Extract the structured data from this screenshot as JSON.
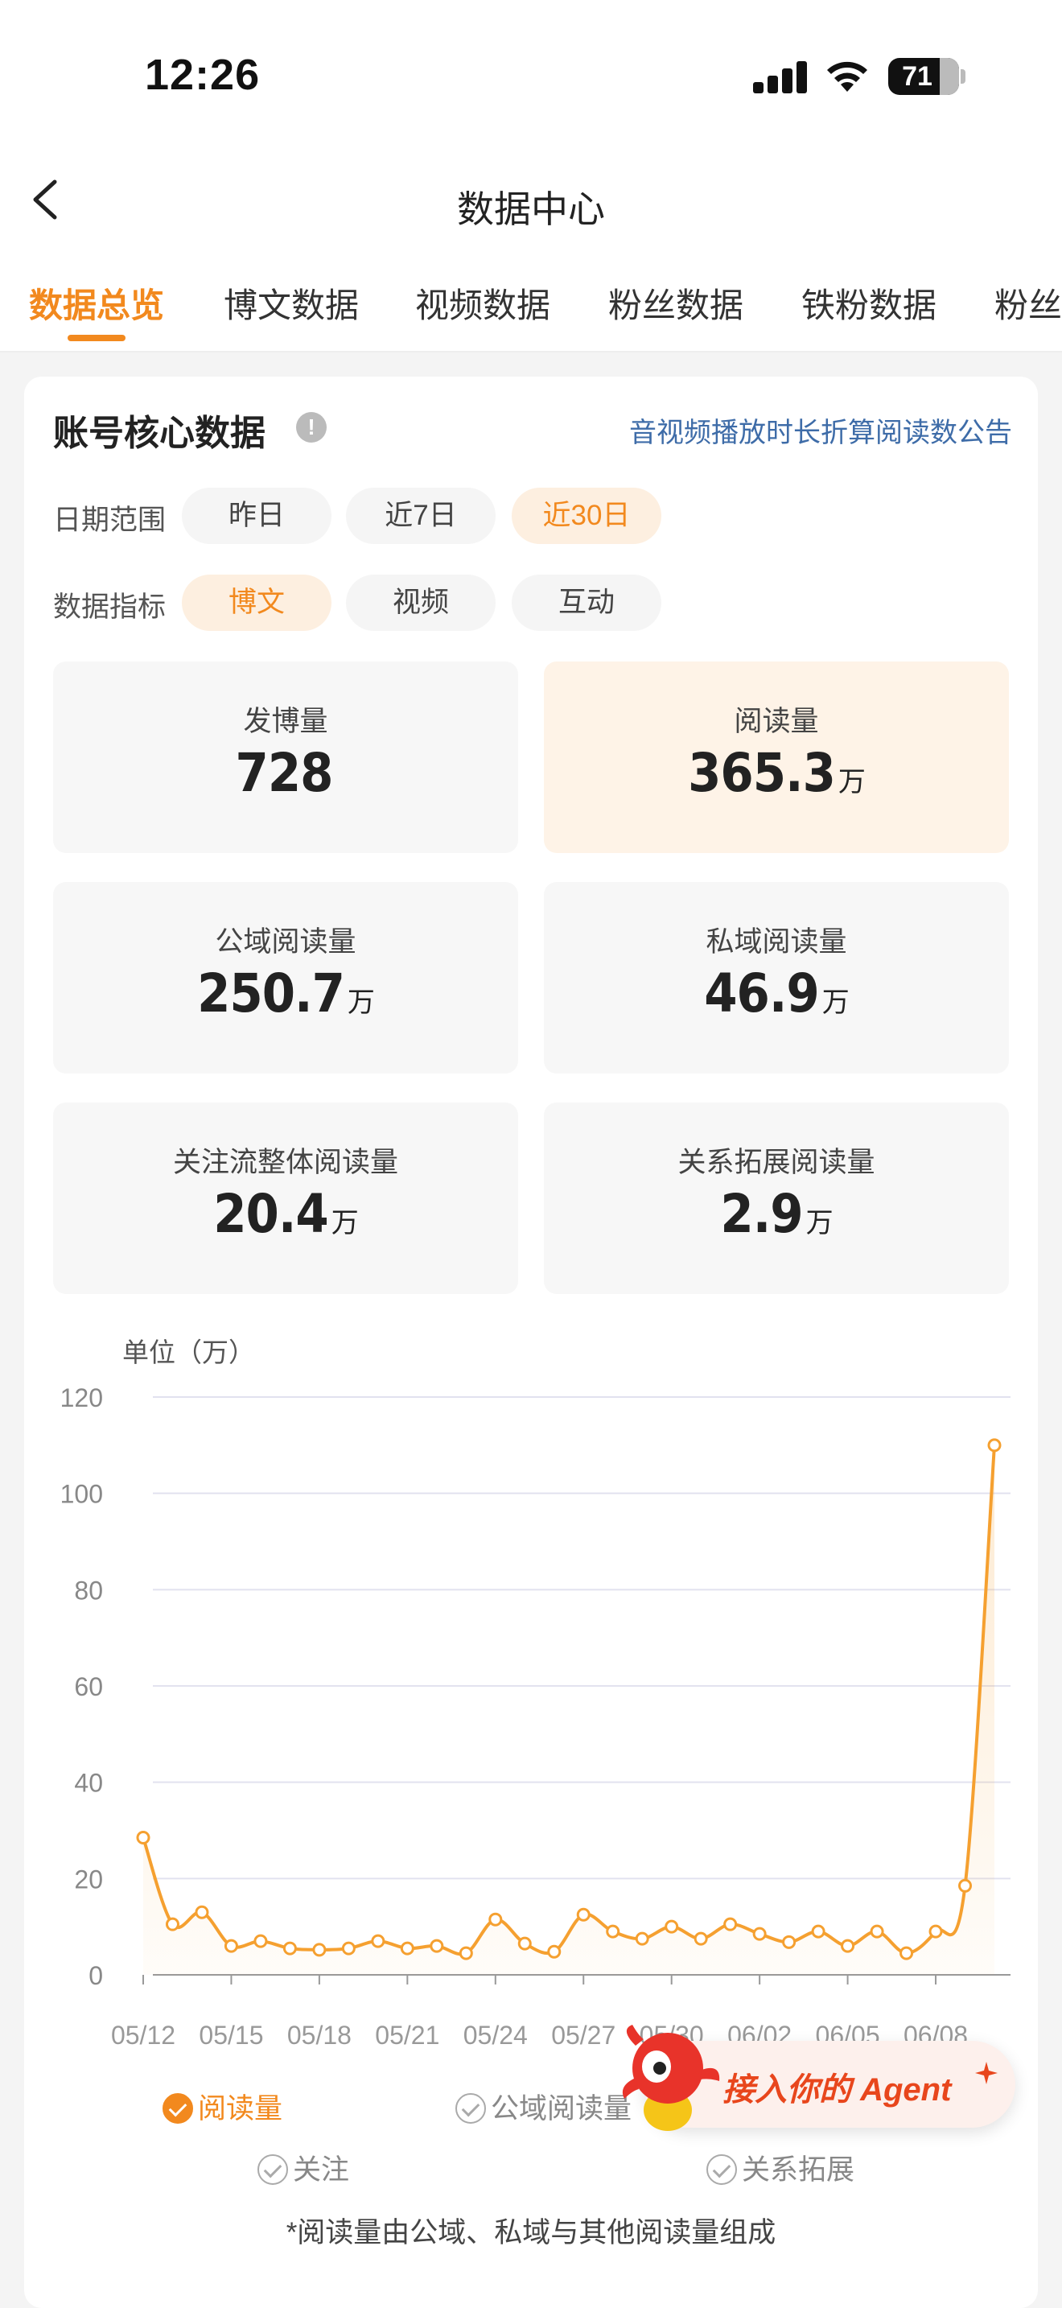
{
  "status_bar": {
    "time": "12:26",
    "battery": "71"
  },
  "nav": {
    "title": "数据中心"
  },
  "tabs": [
    "数据总览",
    "博文数据",
    "视频数据",
    "粉丝数据",
    "铁粉数据",
    "粉丝"
  ],
  "active_tab": "数据总览",
  "card": {
    "title": "账号核心数据",
    "info_icon": "!",
    "notice_link": "音视频播放时长折算阅读数公告",
    "date_range": {
      "label": "日期范围",
      "options": [
        "昨日",
        "近7日",
        "近30日"
      ],
      "selected": "近30日"
    },
    "metric": {
      "label": "数据指标",
      "options": [
        "博文",
        "视频",
        "互动"
      ],
      "selected": "博文"
    },
    "stats": [
      {
        "label": "发博量",
        "value": "728",
        "unit": ""
      },
      {
        "label": "阅读量",
        "value": "365.3",
        "unit": "万"
      },
      {
        "label": "公域阅读量",
        "value": "250.7",
        "unit": "万"
      },
      {
        "label": "私域阅读量",
        "value": "46.9",
        "unit": "万"
      },
      {
        "label": "关注流整体阅读量",
        "value": "20.4",
        "unit": "万"
      },
      {
        "label": "关系拓展阅读量",
        "value": "2.9",
        "unit": "万"
      }
    ],
    "chart_unit": "单位（万）",
    "legend": [
      {
        "label": "阅读量",
        "checked": true
      },
      {
        "label": "公域阅读量",
        "checked": false
      },
      {
        "label": "关注",
        "checked": false
      },
      {
        "label": "关系拓展",
        "checked": false
      }
    ],
    "footnote": "*阅读量由公域、私域与其他阅读量组成"
  },
  "agent_banner": {
    "text": "接入你的 Agent"
  },
  "chart_data": {
    "type": "line",
    "ylim": [
      0,
      120
    ],
    "y_ticks": [
      0,
      20,
      40,
      60,
      80,
      100,
      120
    ],
    "x_tick_labels": [
      "05/12",
      "05/15",
      "05/18",
      "05/21",
      "05/24",
      "05/27",
      "05/30",
      "06/02",
      "06/05",
      "06/08"
    ],
    "x": [
      "05/12",
      "05/13",
      "05/14",
      "05/15",
      "05/16",
      "05/17",
      "05/18",
      "05/19",
      "05/20",
      "05/21",
      "05/22",
      "05/23",
      "05/24",
      "05/25",
      "05/26",
      "05/27",
      "05/28",
      "05/29",
      "05/30",
      "05/31",
      "06/01",
      "06/02",
      "06/03",
      "06/04",
      "06/05",
      "06/06",
      "06/07",
      "06/08",
      "06/09",
      "06/10"
    ],
    "series": [
      {
        "name": "阅读量",
        "color": "#f5a030",
        "values": [
          28.5,
          10.5,
          13,
          6,
          7,
          5.5,
          5.2,
          5.5,
          7,
          5.5,
          6,
          4.5,
          11.5,
          6.5,
          4.8,
          12.5,
          9,
          7.5,
          10,
          7.5,
          10.5,
          8.5,
          6.8,
          9,
          6,
          9,
          4.5,
          9,
          18.5,
          110
        ]
      }
    ],
    "grid": true
  }
}
